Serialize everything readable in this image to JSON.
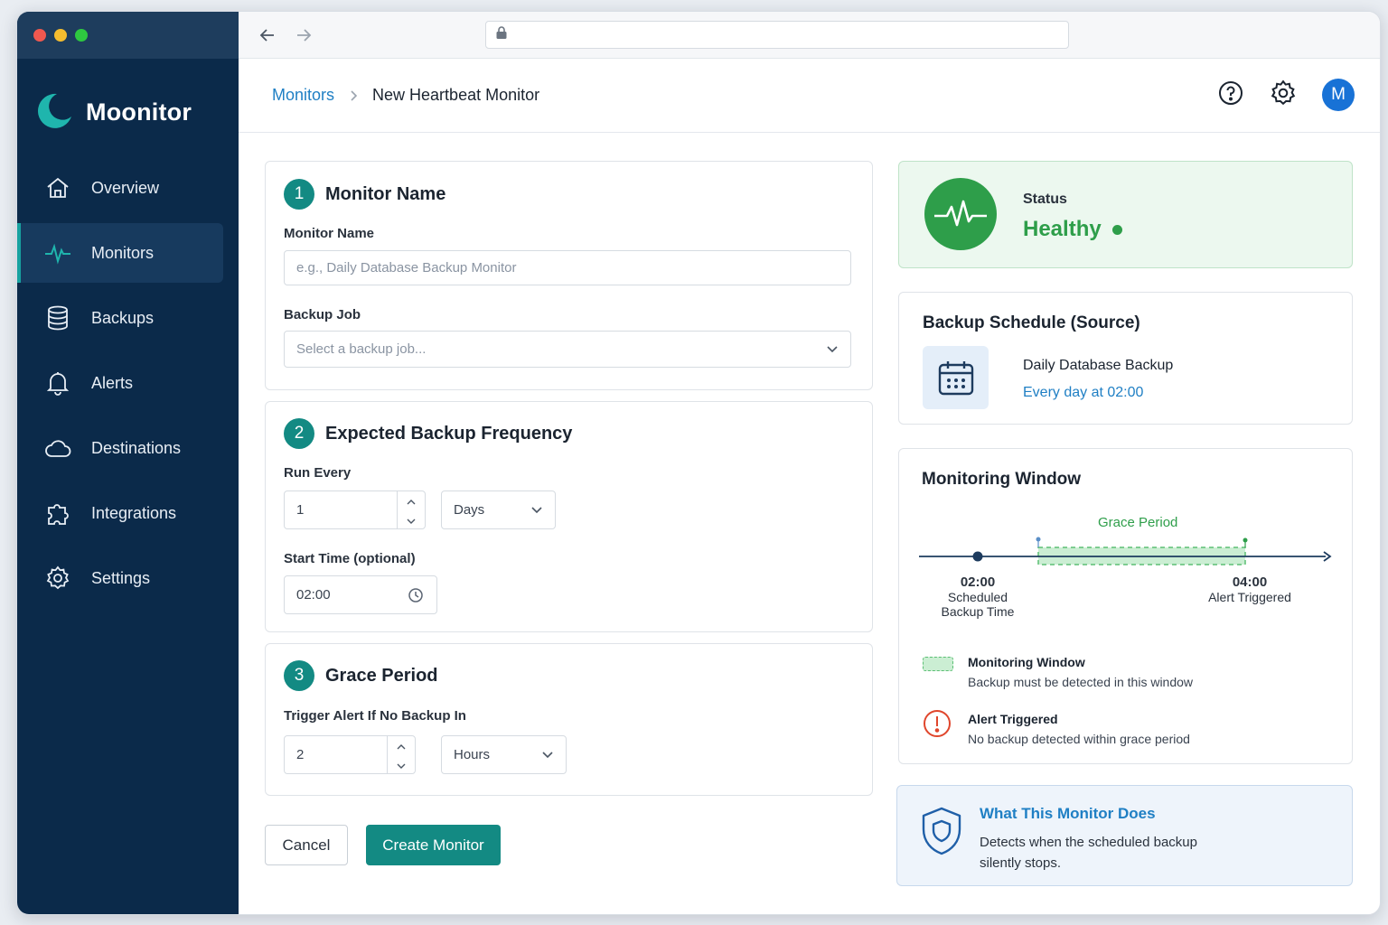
{
  "window": {
    "controls": [
      "close",
      "minimize",
      "maximize"
    ]
  },
  "colors": {
    "sidebar": "#0b2a4a",
    "accent": "#138a83",
    "link": "#1f7fc4",
    "healthy": "#2e9e4a",
    "alert": "#e0462c"
  },
  "sidebar": {
    "brand": "Moonitor",
    "items": [
      {
        "label": "Overview",
        "icon": "home-icon"
      },
      {
        "label": "Monitors",
        "icon": "pulse-icon",
        "active": true
      },
      {
        "label": "Backups",
        "icon": "database-icon"
      },
      {
        "label": "Alerts",
        "icon": "bell-icon"
      },
      {
        "label": "Destinations",
        "icon": "cloud-icon"
      },
      {
        "label": "Integrations",
        "icon": "puzzle-icon"
      },
      {
        "label": "Settings",
        "icon": "gear-icon"
      }
    ]
  },
  "browser": {
    "url": ""
  },
  "header": {
    "breadcrumb_parent": "Monitors",
    "breadcrumb_current": "New Heartbeat Monitor",
    "avatar_initial": "M"
  },
  "form": {
    "step1": {
      "number": "1",
      "title": "Monitor Name",
      "name_label": "Monitor Name",
      "name_placeholder": "e.g., Daily Database Backup Monitor",
      "job_label": "Backup Job",
      "job_placeholder": "Select a backup job..."
    },
    "step2": {
      "number": "2",
      "title": "Expected Backup Frequency",
      "run_every_label": "Run Every",
      "run_every_value": "1",
      "run_every_unit": "Days",
      "start_time_label": "Start Time (optional)",
      "start_time_value": "02:00"
    },
    "step3": {
      "number": "3",
      "title": "Grace Period",
      "trigger_label": "Trigger Alert If No Backup In",
      "trigger_value": "2",
      "trigger_unit": "Hours"
    },
    "cancel_label": "Cancel",
    "create_label": "Create Monitor"
  },
  "status": {
    "label": "Status",
    "value": "Healthy"
  },
  "schedule": {
    "title": "Backup Schedule (Source)",
    "name": "Daily Database Backup",
    "time": "Every day at 02:00"
  },
  "monitoring_window": {
    "title": "Monitoring Window",
    "grace_label": "Grace Period",
    "start_time": "02:00",
    "start_caption_1": "Scheduled",
    "start_caption_2": "Backup Time",
    "end_time": "04:00",
    "end_caption": "Alert Triggered",
    "legend": [
      {
        "title": "Monitoring Window",
        "desc": "Backup must be detected in this window"
      },
      {
        "title": "Alert Triggered",
        "desc": "No backup detected within grace period"
      }
    ]
  },
  "info": {
    "title": "What This Monitor Does",
    "desc": "Detects when the scheduled backup silently stops."
  }
}
